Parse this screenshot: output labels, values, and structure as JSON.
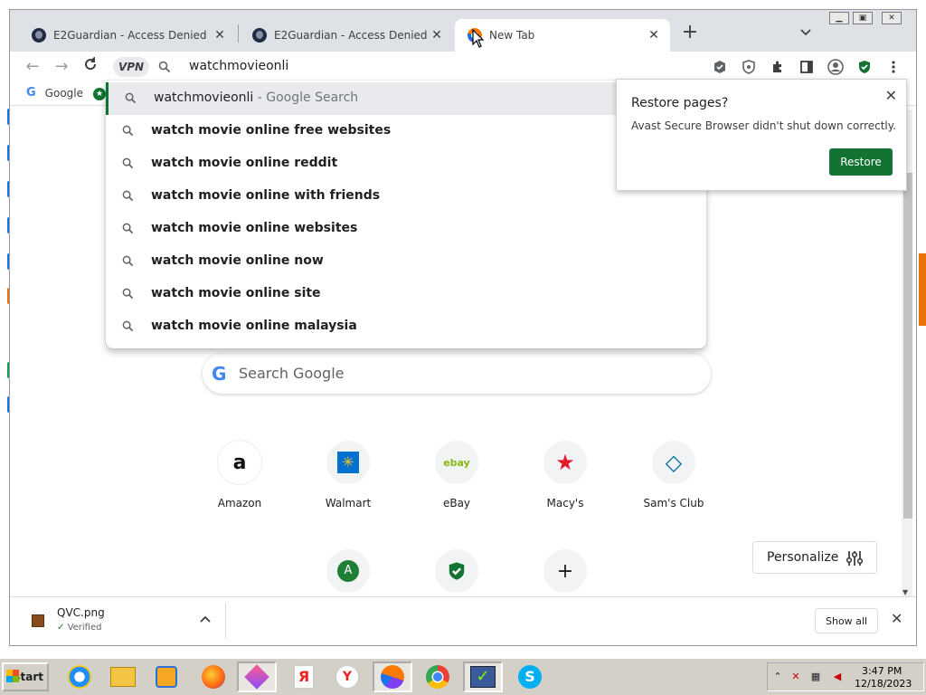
{
  "tabs": [
    {
      "title": "E2Guardian - Access Denied",
      "icon": "globe-icon",
      "active": false
    },
    {
      "title": "E2Guardian - Access Denied",
      "icon": "globe-icon",
      "active": false
    },
    {
      "title": "New Tab",
      "icon": "avast-browser-icon",
      "active": true
    }
  ],
  "toolbar": {
    "vpn_label": "VPN",
    "address_text": "watchmovieonli"
  },
  "bookmarks": [
    {
      "label": "Google"
    }
  ],
  "autocomplete": {
    "first": {
      "text": "watchmovieonli",
      "suffix": " - Google Search"
    },
    "suggestions": [
      "watch movie online free websites",
      "watch movie online reddit",
      "watch movie online with friends",
      "watch movie online websites",
      "watch movie online now",
      "watch movie online site",
      "watch movie online malaysia"
    ]
  },
  "restore_popup": {
    "title": "Restore pages?",
    "message": "Avast Secure Browser didn't shut down correctly.",
    "button": "Restore"
  },
  "ntp": {
    "search_placeholder": "Search Google",
    "google_letter": "G",
    "shortcuts": [
      {
        "label": "Amazon",
        "icon": "amazon-icon",
        "glyph": "a"
      },
      {
        "label": "Walmart",
        "icon": "walmart-icon",
        "glyph": "✳"
      },
      {
        "label": "eBay",
        "icon": "ebay-icon",
        "glyph": "ebay"
      },
      {
        "label": "Macy's",
        "icon": "macys-star-icon",
        "glyph": "★"
      },
      {
        "label": "Sam's Club",
        "icon": "sams-club-icon",
        "glyph": "◇"
      }
    ],
    "shortcuts_row2": [
      {
        "icon": "letter-a-icon",
        "glyph": "A"
      },
      {
        "icon": "shield-check-icon",
        "glyph": "✓"
      },
      {
        "icon": "add-shortcut-icon",
        "glyph": "+"
      }
    ],
    "personalize_label": "Personalize"
  },
  "download_shelf": {
    "filename": "QVC.png",
    "status": "Verified",
    "show_all": "Show all"
  },
  "taskbar": {
    "start_label": "Start",
    "apps": [
      "internet-explorer-icon",
      "file-explorer-icon",
      "media-player-icon",
      "firefox-icon",
      "app-gem-icon",
      "yandex-icon",
      "yandex-browser-icon",
      "avast-browser-icon",
      "chrome-icon",
      "app-check-icon",
      "skype-icon"
    ],
    "clock_time": "3:47 PM",
    "clock_date": "12/18/2023"
  },
  "colors": {
    "accent_green": "#137333",
    "tabstrip": "#dee1e6",
    "taskbar": "#d4d0c8"
  }
}
